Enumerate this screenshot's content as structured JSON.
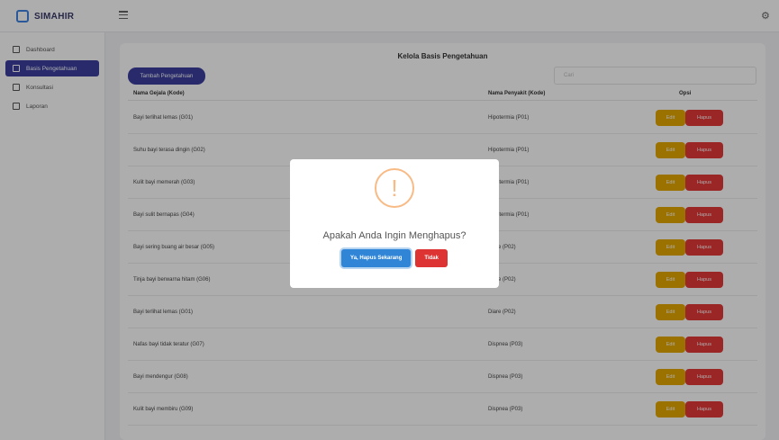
{
  "header": {
    "brand": "SIMAHIR",
    "menu_icon": "hamburger-icon",
    "settings_icon": "gear-icon"
  },
  "sidebar": {
    "items": [
      {
        "label": "Dashboard",
        "icon": "grid-icon",
        "active": false
      },
      {
        "label": "Basis Pengetahuan",
        "icon": "database-icon",
        "active": true
      },
      {
        "label": "Konsultasi",
        "icon": "chat-icon",
        "active": false
      },
      {
        "label": "Laporan",
        "icon": "report-icon",
        "active": false
      }
    ]
  },
  "main": {
    "title": "Kelola Basis Pengetahuan",
    "add_button": "Tambah Pengetahuan",
    "search_placeholder": "Cari",
    "columns": [
      "Nama Gejala (Kode)",
      "Nama Penyakit (Kode)",
      "Opsi"
    ],
    "edit_label": "Edit",
    "delete_label": "Hapus",
    "rows": [
      {
        "gejala": "Bayi terlihat lemas (G01)",
        "penyakit": "Hipotermia (P01)"
      },
      {
        "gejala": "Suhu bayi terasa dingin (G02)",
        "penyakit": "Hipotermia (P01)"
      },
      {
        "gejala": "Kulit bayi memerah (G03)",
        "penyakit": "Hipotermia (P01)"
      },
      {
        "gejala": "Bayi sulit bernapas (G04)",
        "penyakit": "Hipotermia (P01)"
      },
      {
        "gejala": "Bayi sering buang air besar (G05)",
        "penyakit": "Diare (P02)"
      },
      {
        "gejala": "Tinja bayi berwarna hitam (G06)",
        "penyakit": "Diare (P02)"
      },
      {
        "gejala": "Bayi terlihat lemas (G01)",
        "penyakit": "Diare (P02)"
      },
      {
        "gejala": "Nafas bayi tidak teratur (G07)",
        "penyakit": "Dispnea (P03)"
      },
      {
        "gejala": "Bayi mendengur (G08)",
        "penyakit": "Dispnea (P03)"
      },
      {
        "gejala": "Kulit bayi membiru (G09)",
        "penyakit": "Dispnea (P03)"
      }
    ]
  },
  "dialog": {
    "icon": "warning-icon",
    "icon_glyph": "!",
    "message": "Apakah Anda Ingin Menghapus?",
    "confirm_label": "Ya, Hapus Sekarang",
    "cancel_label": "Tidak"
  },
  "colors": {
    "primary": "#3b3e9e",
    "edit": "#e5a700",
    "delete": "#e53838",
    "confirm": "#3085d6",
    "cancel": "#dd3333",
    "warning": "#f8bb86"
  }
}
